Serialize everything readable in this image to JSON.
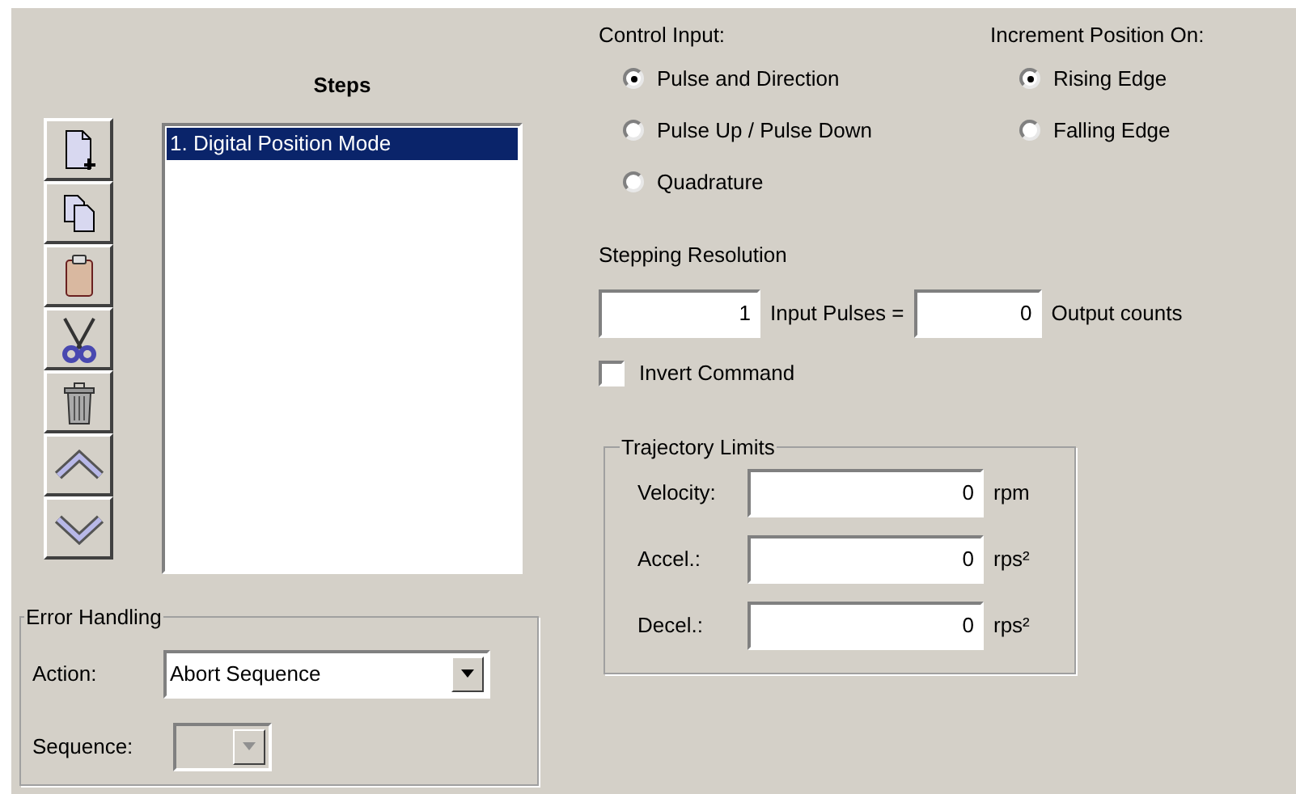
{
  "steps": {
    "title": "Steps",
    "items": [
      {
        "label": "1. Digital Position Mode",
        "selected": true
      }
    ]
  },
  "error_handling": {
    "title": "Error Handling",
    "action": {
      "label": "Action:",
      "value": "Abort Sequence",
      "disabled": false
    },
    "sequence": {
      "label": "Sequence:",
      "disabled": true
    }
  },
  "control_input": {
    "label": "Control Input:",
    "options": [
      {
        "label": "Pulse and Direction",
        "selected": true
      },
      {
        "label": "Pulse Up / Pulse Down",
        "selected": false
      },
      {
        "label": "Quadrature",
        "selected": false
      }
    ]
  },
  "increment_position": {
    "label": "Increment Position On:",
    "options": [
      {
        "label": "Rising Edge",
        "selected": true
      },
      {
        "label": "Falling Edge",
        "selected": false
      }
    ]
  },
  "stepping_resolution": {
    "label": "Stepping Resolution",
    "input_pulses": {
      "value": "1",
      "label": "Input Pulses ="
    },
    "output_counts": {
      "value": "0",
      "label": "Output counts"
    }
  },
  "invert_command": {
    "label": "Invert Command",
    "checked": false
  },
  "trajectory_limits": {
    "title": "Trajectory Limits",
    "rows": [
      {
        "label": "Velocity:",
        "value": "0",
        "unit": "rpm"
      },
      {
        "label": "Accel.:",
        "value": "0",
        "unit": "rps²"
      },
      {
        "label": "Decel.:",
        "value": "0",
        "unit": "rps²"
      }
    ]
  }
}
